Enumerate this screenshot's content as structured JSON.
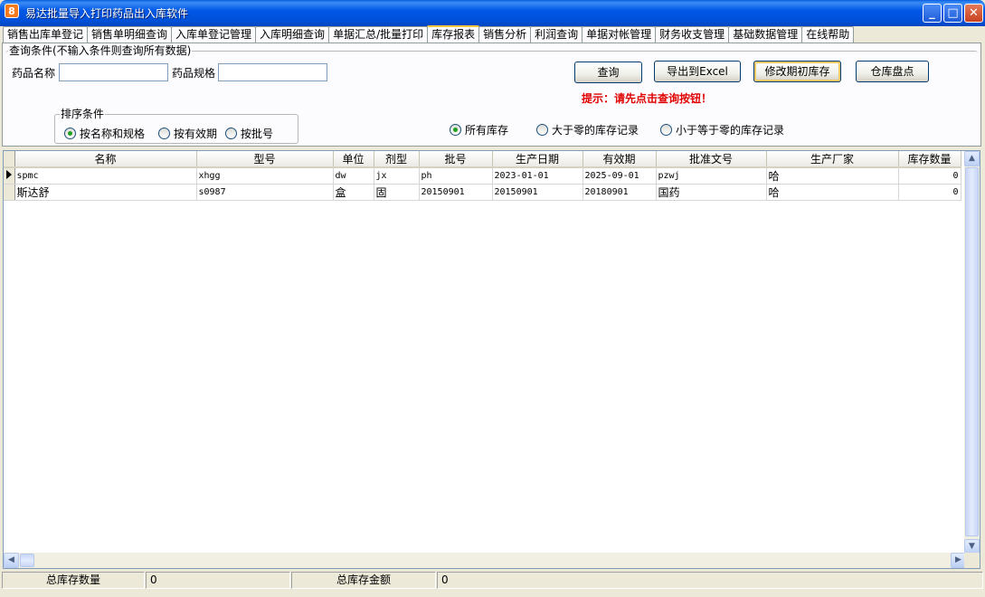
{
  "window": {
    "title": "易达批量导入打印药品出入库软件",
    "icon_letter": "8"
  },
  "tabs": [
    {
      "label": "销售出库单登记",
      "active": false
    },
    {
      "label": "销售单明细查询",
      "active": false
    },
    {
      "label": "入库单登记管理",
      "active": false
    },
    {
      "label": "入库明细查询",
      "active": false
    },
    {
      "label": "单据汇总/批量打印",
      "active": false
    },
    {
      "label": "库存报表",
      "active": true
    },
    {
      "label": "销售分析",
      "active": false
    },
    {
      "label": "利润查询",
      "active": false
    },
    {
      "label": "单据对帐管理",
      "active": false
    },
    {
      "label": "财务收支管理",
      "active": false
    },
    {
      "label": "基础数据管理",
      "active": false
    },
    {
      "label": "在线帮助",
      "active": false
    }
  ],
  "query": {
    "group_title": "查询条件(不输入条件则查询所有数据)",
    "drug_name_label": "药品名称",
    "drug_name_value": "",
    "drug_spec_label": "药品规格",
    "drug_spec_value": ""
  },
  "buttons": {
    "query": "查询",
    "export_excel": "导出到Excel",
    "modify_initial": "修改期初库存",
    "stocktake": "仓库盘点"
  },
  "hint": "提示：请先点击查询按钮！",
  "sort": {
    "group_title": "排序条件",
    "options": [
      {
        "label": "按名称和规格",
        "checked": true
      },
      {
        "label": "按有效期",
        "checked": false
      },
      {
        "label": "按批号",
        "checked": false
      }
    ]
  },
  "stock_filter": {
    "options": [
      {
        "label": "所有库存",
        "checked": true
      },
      {
        "label": "大于零的库存记录",
        "checked": false
      },
      {
        "label": "小于等于零的库存记录",
        "checked": false
      }
    ]
  },
  "grid": {
    "columns": [
      "名称",
      "型号",
      "单位",
      "剂型",
      "批号",
      "生产日期",
      "有效期",
      "批准文号",
      "生产厂家",
      "库存数量"
    ],
    "rows": [
      {
        "name": "spmc",
        "model": "xhgg",
        "unit": "dw",
        "form": "jx",
        "batch": "ph",
        "production_date": "2023-01-01",
        "expiry": "2025-09-01",
        "approval": "pzwj",
        "manufacturer": "哈",
        "qty": "0",
        "current": true
      },
      {
        "name": "斯达舒",
        "model": "s0987",
        "unit": "盒",
        "form": "固",
        "batch": "20150901",
        "production_date": "20150901",
        "expiry": "20180901",
        "approval": "国药",
        "manufacturer": "哈",
        "qty": "0",
        "current": false
      }
    ]
  },
  "status": {
    "total_qty_label": "总库存数量",
    "total_qty_value": "0",
    "total_amount_label": "总库存金额",
    "total_amount_value": "0"
  },
  "colors": {
    "titlebar": "#0058E6",
    "hint": "#E00000",
    "radio_checked": "#21A121",
    "active_tab_accent": "#FFC83C"
  }
}
